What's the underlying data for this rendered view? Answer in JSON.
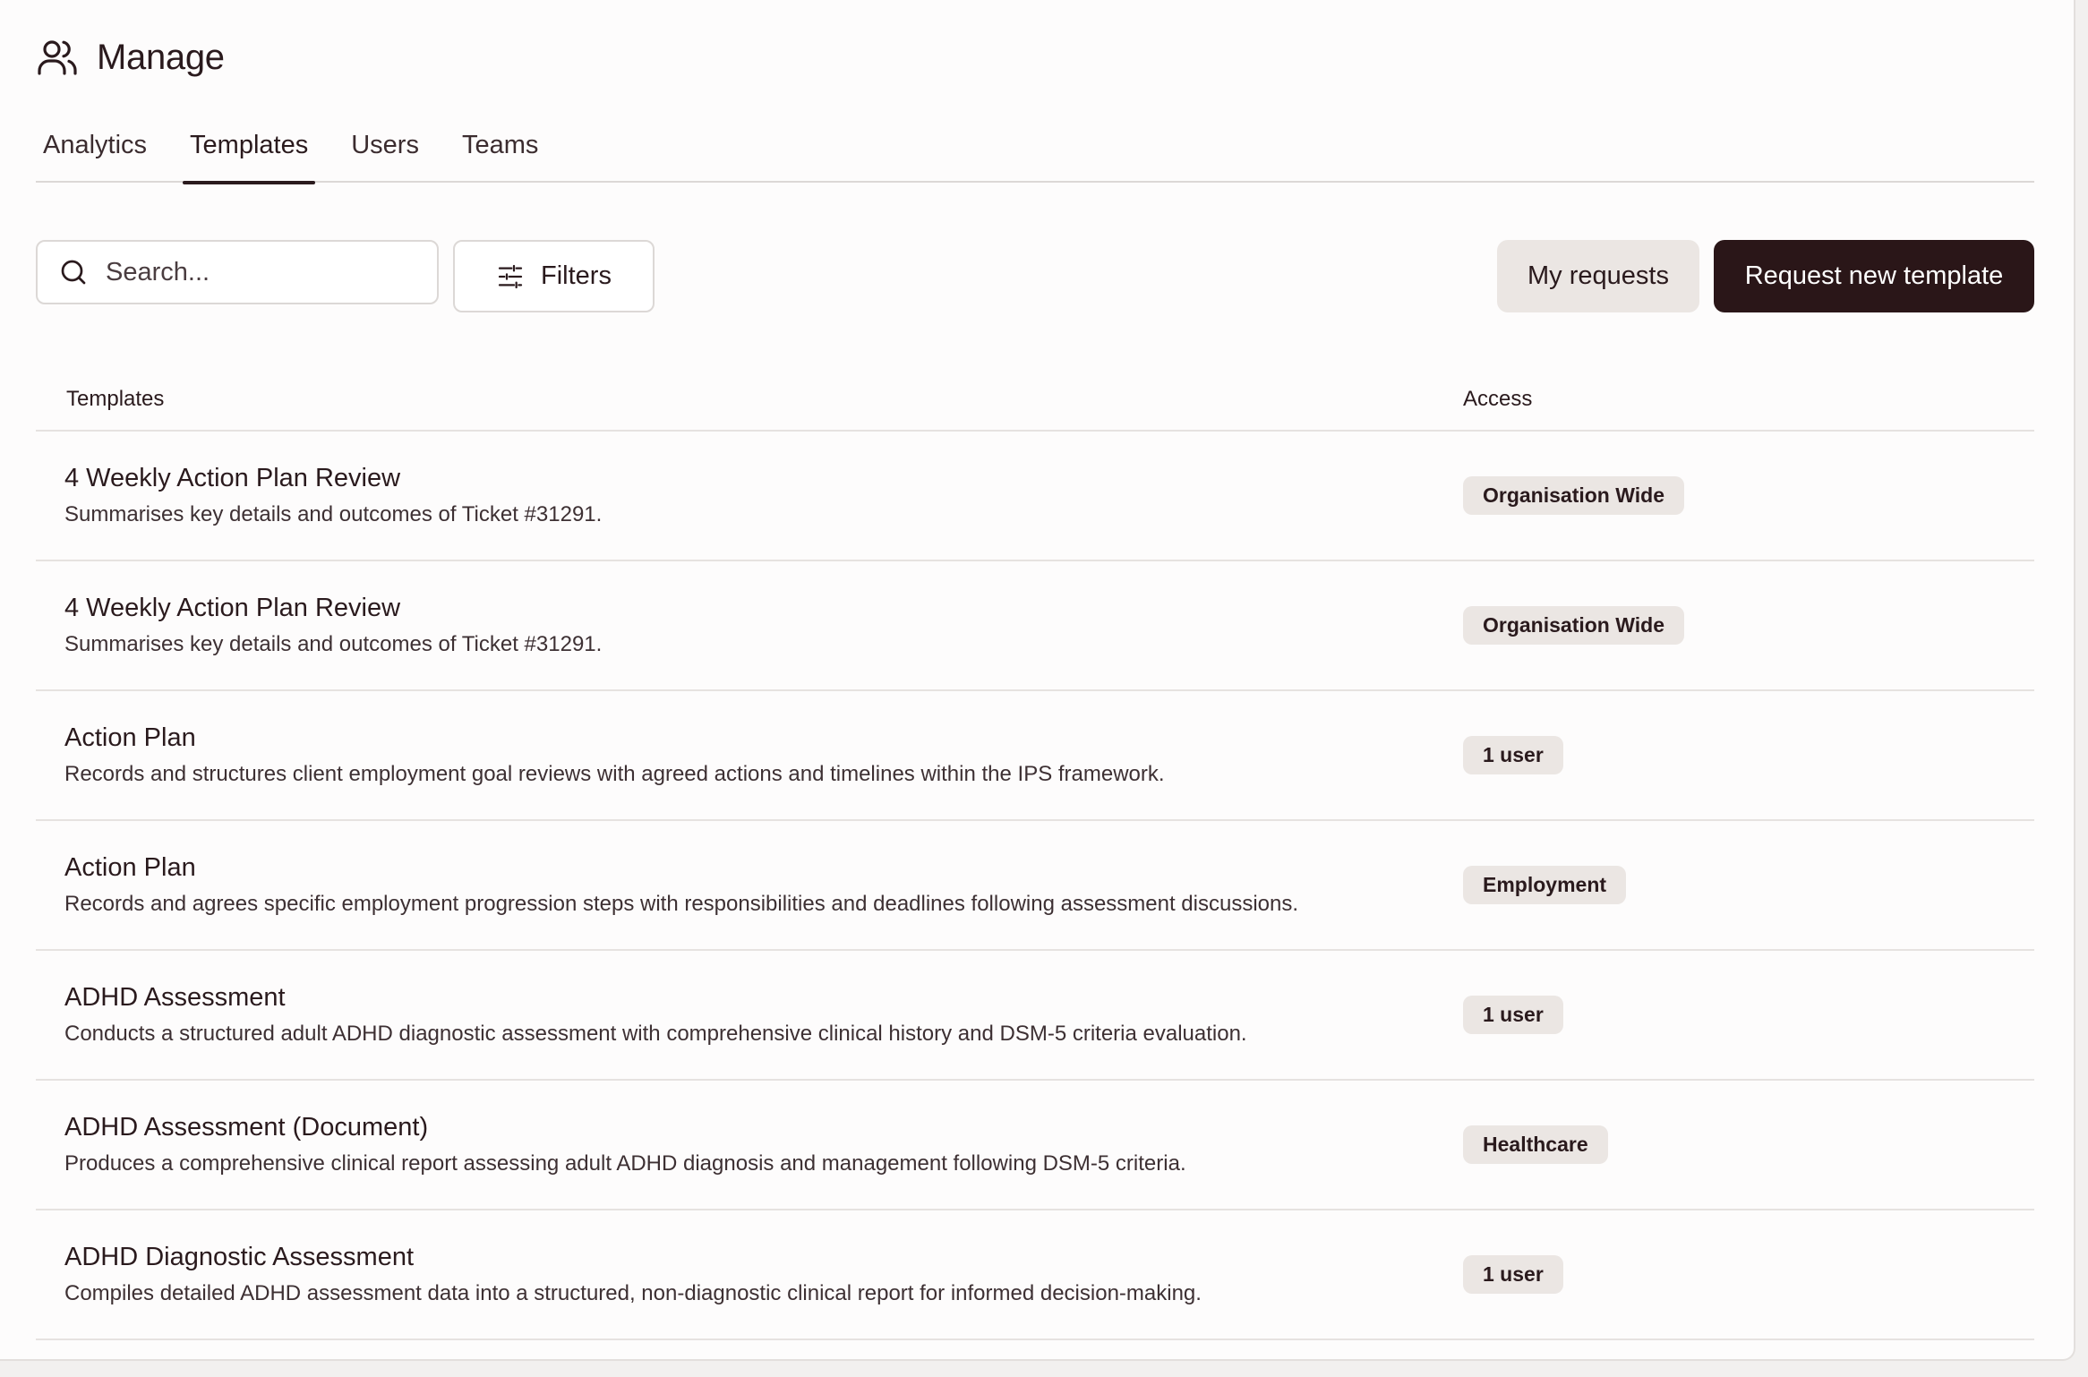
{
  "header": {
    "title": "Manage",
    "icon": "users-icon"
  },
  "tabs": [
    {
      "label": "Analytics",
      "active": false
    },
    {
      "label": "Templates",
      "active": true
    },
    {
      "label": "Users",
      "active": false
    },
    {
      "label": "Teams",
      "active": false
    }
  ],
  "toolbar": {
    "search_placeholder": "Search...",
    "filters_label": "Filters",
    "my_requests_label": "My requests",
    "request_new_label": "Request new template"
  },
  "table": {
    "columns": [
      "Templates",
      "Access"
    ],
    "rows": [
      {
        "name": "4 Weekly Action Plan Review",
        "description": "Summarises key details and outcomes of Ticket #31291.",
        "access": "Organisation Wide"
      },
      {
        "name": "4 Weekly Action Plan Review",
        "description": "Summarises key details and outcomes of Ticket #31291.",
        "access": "Organisation Wide"
      },
      {
        "name": "Action Plan",
        "description": "Records and structures client employment goal reviews with agreed actions and timelines within the IPS framework.",
        "access": "1 user"
      },
      {
        "name": "Action Plan",
        "description": "Records and agrees specific employment progression steps with responsibilities and deadlines following assessment discussions.",
        "access": "Employment"
      },
      {
        "name": "ADHD Assessment",
        "description": "Conducts a structured adult ADHD diagnostic assessment with comprehensive clinical history and DSM-5 criteria evaluation.",
        "access": "1 user"
      },
      {
        "name": "ADHD Assessment (Document)",
        "description": "Produces a comprehensive clinical report assessing adult ADHD diagnosis and management following DSM-5 criteria.",
        "access": "Healthcare"
      },
      {
        "name": "ADHD Diagnostic Assessment",
        "description": "Compiles detailed ADHD assessment data into a structured, non-diagnostic clinical report for informed decision-making.",
        "access": "1 user"
      }
    ]
  },
  "colors": {
    "primary": "#2a1618",
    "badge_bg": "#ebe6e3",
    "text": "#2a1a1d"
  }
}
